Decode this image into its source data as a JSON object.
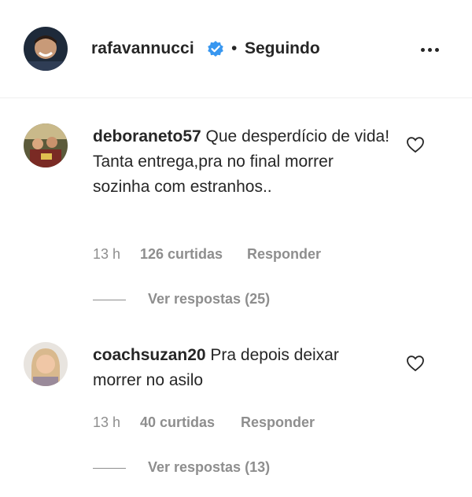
{
  "post_header": {
    "username": "rafavannucci",
    "separator": "•",
    "follow_status": "Seguindo"
  },
  "comments": [
    {
      "username": "deboraneto57",
      "text": "Que desperdício de vida! Tanta entrega,pra no final morrer sozinha com estranhos..",
      "time": "13 h",
      "likes": "126 curtidas",
      "reply_label": "Responder",
      "view_replies": "Ver respostas (25)"
    },
    {
      "username": "coachsuzan20",
      "text": "Pra depois deixar morrer no asilo",
      "time": "13 h",
      "likes": "40 curtidas",
      "reply_label": "Responder",
      "view_replies": "Ver respostas (13)"
    }
  ],
  "colors": {
    "text": "#262626",
    "secondary": "#8e8e8e",
    "verified": "#3897f0",
    "divider": "#efefef"
  }
}
